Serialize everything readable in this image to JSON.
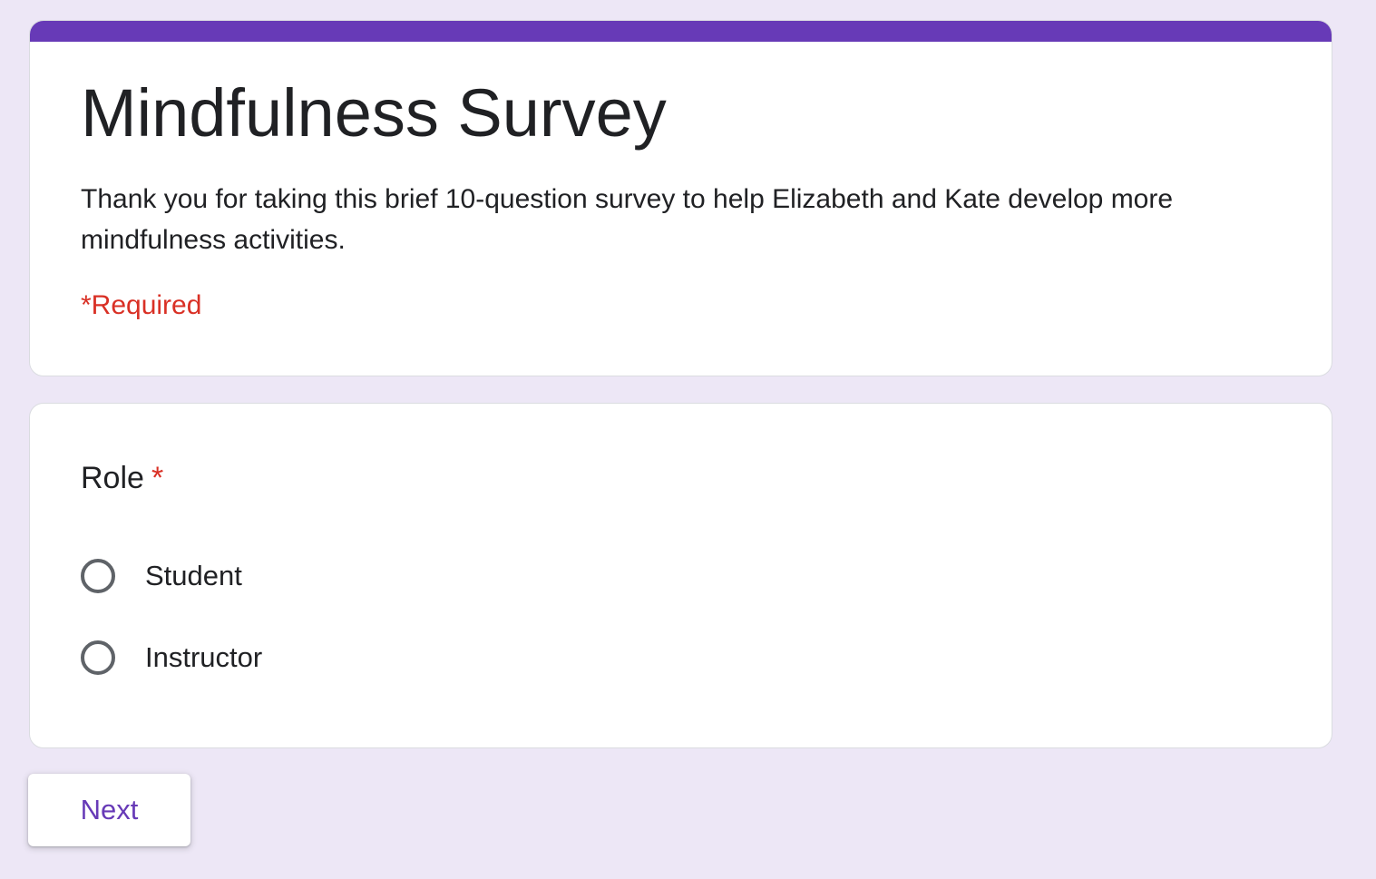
{
  "form": {
    "title": "Mindfulness Survey",
    "description": "Thank you for taking this brief 10-question survey to help Elizabeth and Kate develop more mindfulness activities.",
    "required_note": "*Required",
    "accent_color": "#673ab7",
    "background_color": "#ede7f6",
    "required_color": "#d93025"
  },
  "question": {
    "title": "Role",
    "required_marker": "*",
    "type": "radio",
    "options": [
      {
        "label": "Student",
        "selected": false
      },
      {
        "label": "Instructor",
        "selected": false
      }
    ]
  },
  "navigation": {
    "next_label": "Next"
  }
}
